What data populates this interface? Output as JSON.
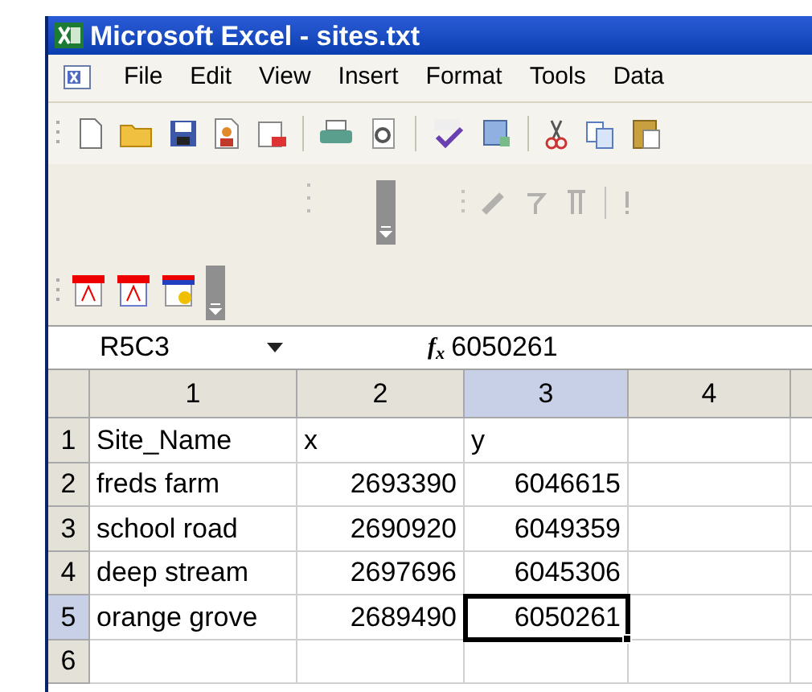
{
  "window": {
    "title": "Microsoft Excel - sites.txt"
  },
  "menu": [
    {
      "label": "File"
    },
    {
      "label": "Edit"
    },
    {
      "label": "View"
    },
    {
      "label": "Insert"
    },
    {
      "label": "Format"
    },
    {
      "label": "Tools"
    },
    {
      "label": "Data"
    }
  ],
  "formula_bar": {
    "name_box": "R5C3",
    "function_label": "f$_{x}$",
    "value": "6050261"
  },
  "columns": [
    {
      "label": "1",
      "selected": false
    },
    {
      "label": "2",
      "selected": false
    },
    {
      "label": "3",
      "selected": true
    },
    {
      "label": "4",
      "selected": false
    }
  ],
  "rows": [
    {
      "label": "1",
      "selected": false,
      "cells": [
        {
          "text": "Site_Name",
          "kind": "text",
          "selected": false
        },
        {
          "text": "x",
          "kind": "text",
          "selected": false
        },
        {
          "text": "y",
          "kind": "text",
          "selected": false
        }
      ]
    },
    {
      "label": "2",
      "selected": false,
      "cells": [
        {
          "text": "freds farm",
          "kind": "text",
          "selected": false
        },
        {
          "text": "2693390",
          "kind": "number",
          "selected": false
        },
        {
          "text": "6046615",
          "kind": "number",
          "selected": false
        }
      ]
    },
    {
      "label": "3",
      "selected": false,
      "cells": [
        {
          "text": "school road",
          "kind": "text",
          "selected": false
        },
        {
          "text": "2690920",
          "kind": "number",
          "selected": false
        },
        {
          "text": "6049359",
          "kind": "number",
          "selected": false
        }
      ]
    },
    {
      "label": "4",
      "selected": false,
      "cells": [
        {
          "text": "deep stream",
          "kind": "text",
          "selected": false
        },
        {
          "text": "2697696",
          "kind": "number",
          "selected": false
        },
        {
          "text": "6045306",
          "kind": "number",
          "selected": false
        }
      ]
    },
    {
      "label": "5",
      "selected": true,
      "cells": [
        {
          "text": "orange grove",
          "kind": "text",
          "selected": false
        },
        {
          "text": "2689490",
          "kind": "number",
          "selected": false
        },
        {
          "text": "6050261",
          "kind": "number",
          "selected": true
        }
      ]
    },
    {
      "label": "6",
      "selected": false,
      "cells": []
    }
  ]
}
